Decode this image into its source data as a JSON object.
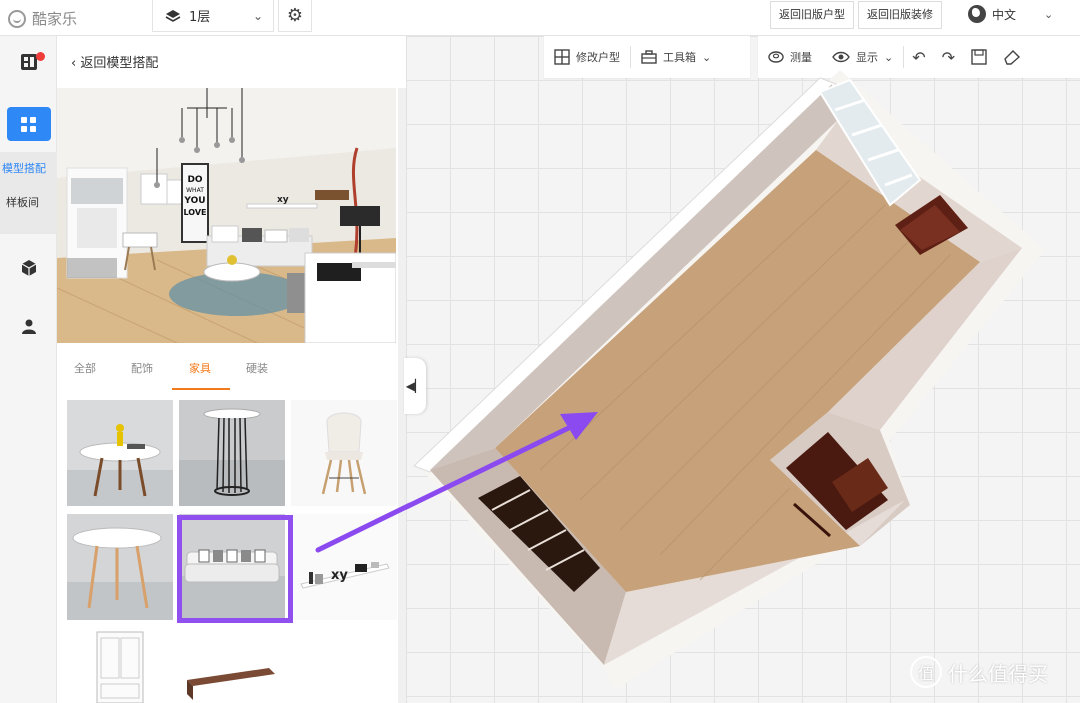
{
  "app": {
    "logo_text": "酷家乐"
  },
  "topbar": {
    "floor_label": "1层",
    "btn_old_layout": "返回旧版户型",
    "btn_old_decor": "返回旧版装修",
    "language": "中文"
  },
  "leftnav": {
    "sub_items": [
      "模型搭配",
      "样板间"
    ]
  },
  "panel": {
    "back_label": "返回模型搭配",
    "preview_sign_lines": [
      "DO",
      "WHAT",
      "YOU",
      "LOVE"
    ],
    "shelf_text": "xy",
    "tabs": [
      {
        "label": "全部"
      },
      {
        "label": "配饰"
      },
      {
        "label": "家具",
        "active": true
      },
      {
        "label": "硬装"
      }
    ],
    "selected_item": "sofa",
    "thumb_shelf_text": "xy"
  },
  "toolbar": {
    "items": [
      "修改户型",
      "工具箱",
      "测量",
      "显示"
    ]
  },
  "watermark": {
    "text": "什么值得买",
    "symbol": "值"
  },
  "colors": {
    "accent_blue": "#2e88f5",
    "tab_active": "#f27a1a",
    "highlight": "#9050f0",
    "arrow": "#8a4af0"
  }
}
